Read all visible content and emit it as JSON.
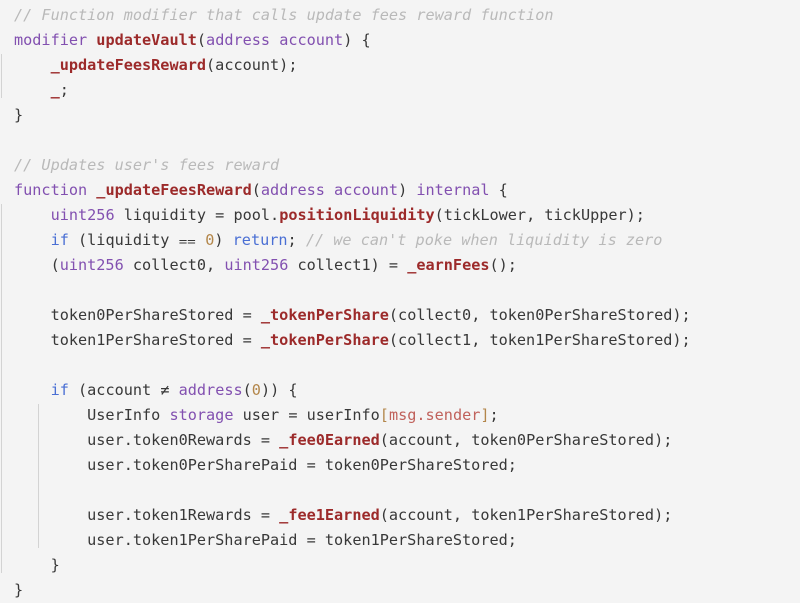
{
  "editor": {
    "background_color": "#f4f4f4",
    "language": "solidity",
    "font_size_px": 15,
    "line_height_px": 25,
    "indent_guide_color": "#d3d3d3",
    "colors": {
      "comment": "#b9b9b9",
      "keyword": "#8250b0",
      "control_keyword": "#4a6fd4",
      "function_name": "#9c2a2a",
      "plain_text": "#383838",
      "number_literal": "#b3864a",
      "builtin_member": "#c0615b",
      "bracket": "#b3864a"
    }
  },
  "code": {
    "title": "updateVault modifier and _updateFeesReward internal function",
    "lines": [
      {
        "n": 1,
        "indent": 0,
        "text": "// Function modifier that calls update fees reward function",
        "tokens": [
          {
            "t": "// Function modifier that calls update fees reward function",
            "c": "tok-comment"
          }
        ]
      },
      {
        "n": 2,
        "indent": 0,
        "text": "modifier updateVault(address account) {",
        "tokens": [
          {
            "t": "modifier ",
            "c": "tok-keyword"
          },
          {
            "t": "updateVault",
            "c": "tok-func"
          },
          {
            "t": "(",
            "c": "tok-plain"
          },
          {
            "t": "address account",
            "c": "tok-keyword"
          },
          {
            "t": ") {",
            "c": "tok-plain"
          }
        ]
      },
      {
        "n": 3,
        "indent": 1,
        "text": "    _updateFeesReward(account);",
        "tokens": [
          {
            "t": "    ",
            "c": "tok-plain"
          },
          {
            "t": "_updateFeesReward",
            "c": "tok-func"
          },
          {
            "t": "(account);",
            "c": "tok-plain"
          }
        ]
      },
      {
        "n": 4,
        "indent": 1,
        "text": "    _;",
        "tokens": [
          {
            "t": "    ",
            "c": "tok-plain"
          },
          {
            "t": "_",
            "c": "tok-func"
          },
          {
            "t": ";",
            "c": "tok-plain"
          }
        ]
      },
      {
        "n": 5,
        "indent": 0,
        "text": "}",
        "tokens": [
          {
            "t": "}",
            "c": "tok-plain"
          }
        ]
      },
      {
        "n": 6,
        "indent": 0,
        "text": "",
        "tokens": []
      },
      {
        "n": 7,
        "indent": 0,
        "text": "// Updates user's fees reward",
        "tokens": [
          {
            "t": "// Updates user's fees reward",
            "c": "tok-comment"
          }
        ]
      },
      {
        "n": 8,
        "indent": 0,
        "text": "function _updateFeesReward(address account) internal {",
        "tokens": [
          {
            "t": "function ",
            "c": "tok-keyword"
          },
          {
            "t": "_updateFeesReward",
            "c": "tok-func"
          },
          {
            "t": "(",
            "c": "tok-plain"
          },
          {
            "t": "address account",
            "c": "tok-keyword"
          },
          {
            "t": ") ",
            "c": "tok-plain"
          },
          {
            "t": "internal",
            "c": "tok-keyword"
          },
          {
            "t": " {",
            "c": "tok-plain"
          }
        ]
      },
      {
        "n": 9,
        "indent": 1,
        "text": "    uint256 liquidity = pool.positionLiquidity(tickLower, tickUpper);",
        "tokens": [
          {
            "t": "    ",
            "c": "tok-plain"
          },
          {
            "t": "uint256",
            "c": "tok-keyword"
          },
          {
            "t": " liquidity = pool.",
            "c": "tok-plain"
          },
          {
            "t": "positionLiquidity",
            "c": "tok-func"
          },
          {
            "t": "(tickLower, tickUpper);",
            "c": "tok-plain"
          }
        ]
      },
      {
        "n": 10,
        "indent": 1,
        "text": "    if (liquidity == 0) return; // we can't poke when liquidity is zero",
        "tokens": [
          {
            "t": "    ",
            "c": "tok-plain"
          },
          {
            "t": "if",
            "c": "tok-control"
          },
          {
            "t": " (liquidity ",
            "c": "tok-plain"
          },
          {
            "t": "⩵",
            "c": "tok-op"
          },
          {
            "t": " ",
            "c": "tok-plain"
          },
          {
            "t": "0",
            "c": "tok-number"
          },
          {
            "t": ") ",
            "c": "tok-plain"
          },
          {
            "t": "return",
            "c": "tok-control"
          },
          {
            "t": "; ",
            "c": "tok-plain"
          },
          {
            "t": "// we can't poke when liquidity is zero",
            "c": "tok-comment"
          }
        ]
      },
      {
        "n": 11,
        "indent": 1,
        "text": "    (uint256 collect0, uint256 collect1) = _earnFees();",
        "tokens": [
          {
            "t": "    (",
            "c": "tok-plain"
          },
          {
            "t": "uint256",
            "c": "tok-keyword"
          },
          {
            "t": " collect0, ",
            "c": "tok-plain"
          },
          {
            "t": "uint256",
            "c": "tok-keyword"
          },
          {
            "t": " collect1) = ",
            "c": "tok-plain"
          },
          {
            "t": "_earnFees",
            "c": "tok-func"
          },
          {
            "t": "();",
            "c": "tok-plain"
          }
        ]
      },
      {
        "n": 12,
        "indent": 1,
        "text": "",
        "tokens": []
      },
      {
        "n": 13,
        "indent": 1,
        "text": "    token0PerShareStored = _tokenPerShare(collect0, token0PerShareStored);",
        "tokens": [
          {
            "t": "    token0PerShareStored = ",
            "c": "tok-plain"
          },
          {
            "t": "_tokenPerShare",
            "c": "tok-func"
          },
          {
            "t": "(collect0, token0PerShareStored);",
            "c": "tok-plain"
          }
        ]
      },
      {
        "n": 14,
        "indent": 1,
        "text": "    token1PerShareStored = _tokenPerShare(collect1, token1PerShareStored);",
        "tokens": [
          {
            "t": "    token1PerShareStored = ",
            "c": "tok-plain"
          },
          {
            "t": "_tokenPerShare",
            "c": "tok-func"
          },
          {
            "t": "(collect1, token1PerShareStored);",
            "c": "tok-plain"
          }
        ]
      },
      {
        "n": 15,
        "indent": 1,
        "text": "",
        "tokens": []
      },
      {
        "n": 16,
        "indent": 1,
        "text": "    if (account != address(0)) {",
        "tokens": [
          {
            "t": "    ",
            "c": "tok-plain"
          },
          {
            "t": "if",
            "c": "tok-control"
          },
          {
            "t": " (account ",
            "c": "tok-plain"
          },
          {
            "t": "≠",
            "c": "tok-op"
          },
          {
            "t": " ",
            "c": "tok-plain"
          },
          {
            "t": "address",
            "c": "tok-keyword"
          },
          {
            "t": "(",
            "c": "tok-plain"
          },
          {
            "t": "0",
            "c": "tok-number"
          },
          {
            "t": ")) {",
            "c": "tok-plain"
          }
        ]
      },
      {
        "n": 17,
        "indent": 2,
        "text": "        UserInfo storage user = userInfo[msg.sender];",
        "tokens": [
          {
            "t": "        UserInfo ",
            "c": "tok-plain"
          },
          {
            "t": "storage",
            "c": "tok-keyword"
          },
          {
            "t": " user = userInfo",
            "c": "tok-plain"
          },
          {
            "t": "[",
            "c": "tok-bracket"
          },
          {
            "t": "msg.sender",
            "c": "tok-builtin"
          },
          {
            "t": "]",
            "c": "tok-bracket"
          },
          {
            "t": ";",
            "c": "tok-plain"
          }
        ]
      },
      {
        "n": 18,
        "indent": 2,
        "text": "        user.token0Rewards = _fee0Earned(account, token0PerShareStored);",
        "tokens": [
          {
            "t": "        user.token0Rewards = ",
            "c": "tok-plain"
          },
          {
            "t": "_fee0Earned",
            "c": "tok-func"
          },
          {
            "t": "(account, token0PerShareStored);",
            "c": "tok-plain"
          }
        ]
      },
      {
        "n": 19,
        "indent": 2,
        "text": "        user.token0PerSharePaid = token0PerShareStored;",
        "tokens": [
          {
            "t": "        user.token0PerSharePaid = token0PerShareStored;",
            "c": "tok-plain"
          }
        ]
      },
      {
        "n": 20,
        "indent": 2,
        "text": "",
        "tokens": []
      },
      {
        "n": 21,
        "indent": 2,
        "text": "        user.token1Rewards = _fee1Earned(account, token1PerShareStored);",
        "tokens": [
          {
            "t": "        user.token1Rewards = ",
            "c": "tok-plain"
          },
          {
            "t": "_fee1Earned",
            "c": "tok-func"
          },
          {
            "t": "(account, token1PerShareStored);",
            "c": "tok-plain"
          }
        ]
      },
      {
        "n": 22,
        "indent": 2,
        "text": "        user.token1PerSharePaid = token1PerShareStored;",
        "tokens": [
          {
            "t": "        user.token1PerSharePaid = token1PerShareStored;",
            "c": "tok-plain"
          }
        ]
      },
      {
        "n": 23,
        "indent": 1,
        "text": "    }",
        "tokens": [
          {
            "t": "    }",
            "c": "tok-plain"
          }
        ]
      },
      {
        "n": 24,
        "indent": 0,
        "text": "}",
        "tokens": [
          {
            "t": "}",
            "c": "tok-plain"
          }
        ]
      }
    ]
  }
}
